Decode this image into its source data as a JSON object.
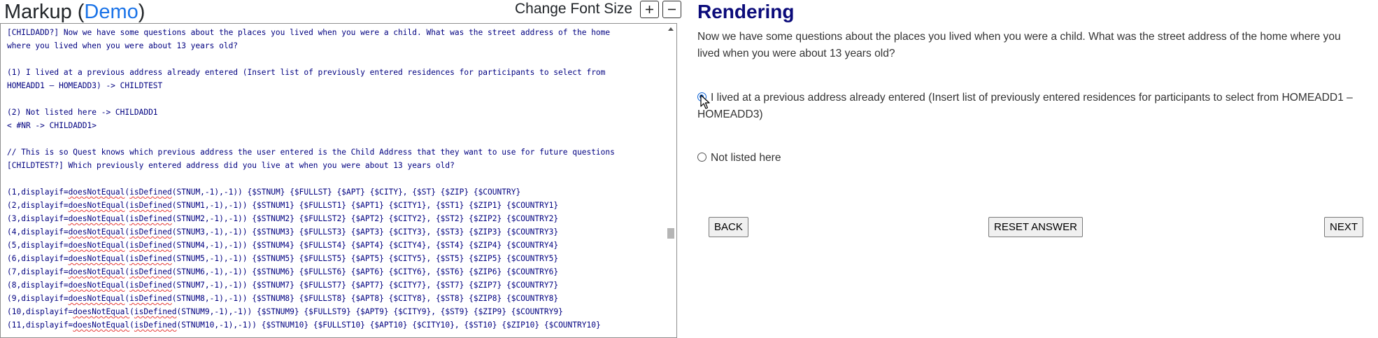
{
  "markup": {
    "title_prefix": "Markup (",
    "title_link": "Demo",
    "title_suffix": ")",
    "font_size_label": "Change Font Size",
    "increase_icon": "plus-square-icon",
    "decrease_icon": "minus-square-icon",
    "lines": [
      "[CHILDADD?] Now we have some questions about the places you lived when you were a child. What was the street address of the home",
      "where you lived when you were about 13 years old?",
      "",
      "(1) I lived at a previous address already entered (Insert list of previously entered residences for participants to select from",
      "HOMEADD1 – HOMEADD3) -> CHILDTEST",
      "",
      "(2) Not listed here -> CHILDADD1",
      "< #NR -> CHILDADD1>",
      "",
      "// This is so Quest knows which previous address the user entered is the Child Address that they want to use for future questions",
      "[CHILDTEST?] Which previously entered address did you live at when you were about 13 years old?",
      ""
    ],
    "display_lines": [
      {
        "prefix": "(1,displayif=",
        "fn1": "doesNotEqual",
        "mid": "(",
        "fn2": "isDefined",
        "rest": "(STNUM,-1),-1)) {$STNUM} {$FULLST} {$APT} {$CITY}, {$ST} {$ZIP} {$COUNTRY}"
      },
      {
        "prefix": "(2,displayif=",
        "fn1": "doesNotEqual",
        "mid": "(",
        "fn2": "isDefined",
        "rest": "(STNUM1,-1),-1)) {$STNUM1} {$FULLST1} {$APT1} {$CITY1}, {$ST1} {$ZIP1} {$COUNTRY1}"
      },
      {
        "prefix": "(3,displayif=",
        "fn1": "doesNotEqual",
        "mid": "(",
        "fn2": "isDefined",
        "rest": "(STNUM2,-1),-1)) {$STNUM2} {$FULLST2} {$APT2} {$CITY2}, {$ST2} {$ZIP2} {$COUNTRY2}"
      },
      {
        "prefix": "(4,displayif=",
        "fn1": "doesNotEqual",
        "mid": "(",
        "fn2": "isDefined",
        "rest": "(STNUM3,-1),-1)) {$STNUM3} {$FULLST3} {$APT3} {$CITY3}, {$ST3} {$ZIP3} {$COUNTRY3}"
      },
      {
        "prefix": "(5,displayif=",
        "fn1": "doesNotEqual",
        "mid": "(",
        "fn2": "isDefined",
        "rest": "(STNUM4,-1),-1)) {$STNUM4} {$FULLST4} {$APT4} {$CITY4}, {$ST4} {$ZIP4} {$COUNTRY4}"
      },
      {
        "prefix": "(6,displayif=",
        "fn1": "doesNotEqual",
        "mid": "(",
        "fn2": "isDefined",
        "rest": "(STNUM5,-1),-1)) {$STNUM5} {$FULLST5} {$APT5} {$CITY5}, {$ST5} {$ZIP5} {$COUNTRY5}"
      },
      {
        "prefix": "(7,displayif=",
        "fn1": "doesNotEqual",
        "mid": "(",
        "fn2": "isDefined",
        "rest": "(STNUM6,-1),-1)) {$STNUM6} {$FULLST6} {$APT6} {$CITY6}, {$ST6} {$ZIP6} {$COUNTRY6}"
      },
      {
        "prefix": "(8,displayif=",
        "fn1": "doesNotEqual",
        "mid": "(",
        "fn2": "isDefined",
        "rest": "(STNUM7,-1),-1)) {$STNUM7} {$FULLST7} {$APT7} {$CITY7}, {$ST7} {$ZIP7} {$COUNTRY7}"
      },
      {
        "prefix": "(9,displayif=",
        "fn1": "doesNotEqual",
        "mid": "(",
        "fn2": "isDefined",
        "rest": "(STNUM8,-1),-1)) {$STNUM8} {$FULLST8} {$APT8} {$CITY8}, {$ST8} {$ZIP8} {$COUNTRY8}"
      },
      {
        "prefix": "(10,displayif=",
        "fn1": "doesNotEqual",
        "mid": "(",
        "fn2": "isDefined",
        "rest": "(STNUM9,-1),-1)) {$STNUM9} {$FULLST9} {$APT9} {$CITY9}, {$ST9} {$ZIP9} {$COUNTRY9}"
      },
      {
        "prefix": "(11,displayif=",
        "fn1": "doesNotEqual",
        "mid": "(",
        "fn2": "isDefined",
        "rest": "(STNUM10,-1),-1)) {$STNUM10} {$FULLST10} {$APT10} {$CITY10}, {$ST10} {$ZIP10} {$COUNTRY10}"
      }
    ]
  },
  "rendering": {
    "title": "Rendering",
    "question": "Now we have some questions about the places you lived when you were a child. What was the street address of the home where you lived when you were about 13 years old?",
    "options": [
      {
        "label": "I lived at a previous address already entered (Insert list of previously entered residences for participants to select from HOMEADD1 – HOMEADD3)",
        "checked": true
      },
      {
        "label": "Not listed here",
        "checked": false
      }
    ],
    "buttons": {
      "back": "BACK",
      "reset": "RESET ANSWER",
      "next": "NEXT"
    }
  },
  "colors": {
    "markup_text": "#000080",
    "rendering_title": "#0b0b7a",
    "demo_link": "#1a73e8",
    "radio_selected": "#0b62d6"
  }
}
